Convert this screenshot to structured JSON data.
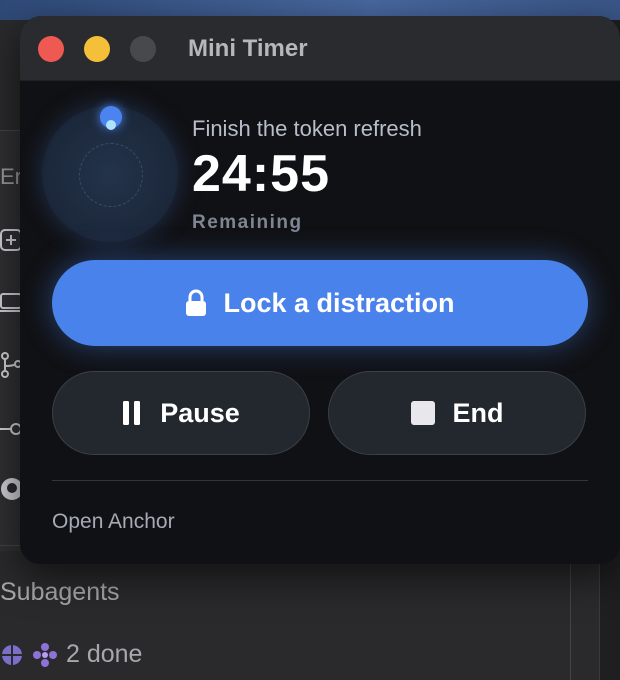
{
  "window": {
    "title": "Mini Timer"
  },
  "timer": {
    "task": "Finish the token refresh",
    "time": "24:55",
    "status": "Remaining"
  },
  "actions": {
    "primary_label": "Lock a distraction",
    "pause_label": "Pause",
    "end_label": "End",
    "link_label": "Open Anchor"
  },
  "background": {
    "sidebar_fragment": "Er",
    "section_title": "Subagents",
    "status": "2 done"
  },
  "colors": {
    "accent": "#4a82ec",
    "window_bg": "#101114",
    "close": "#ee5a52",
    "minimize": "#f5bf3a"
  }
}
